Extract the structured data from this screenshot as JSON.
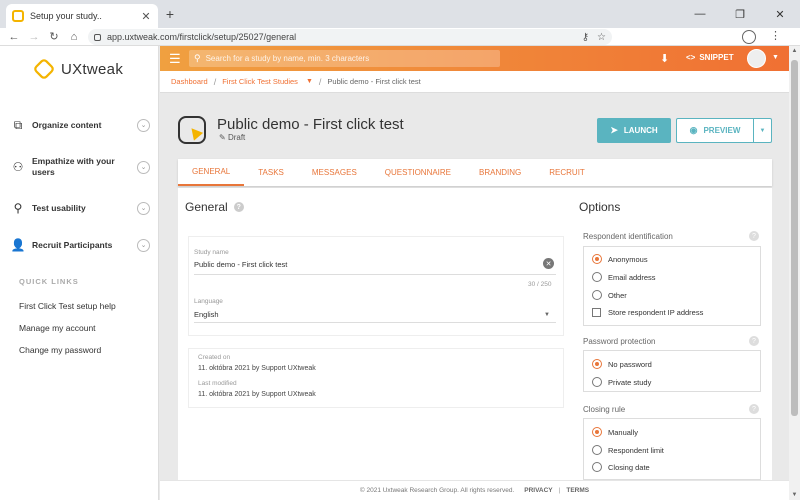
{
  "browser": {
    "tab_title": "Setup your study..",
    "url": "app.uxtweak.com/firstclick/setup/25027/general",
    "new_tab": "+",
    "min": "—",
    "max": "❐",
    "close": "✕"
  },
  "sidebar": {
    "logo": "UXtweak",
    "items": [
      {
        "label": "Organize content",
        "icon": "sitemap-icon"
      },
      {
        "label": "Empathize with your users",
        "icon": "persona-icon"
      },
      {
        "label": "Test usability",
        "icon": "tree-icon"
      },
      {
        "label": "Recruit Participants",
        "icon": "user-icon"
      }
    ],
    "quick_links_heading": "QUICK LINKS",
    "quick_links": [
      "First Click Test setup help",
      "Manage my account",
      "Change my password"
    ]
  },
  "header": {
    "search_placeholder": "Search for a study by name, min. 3 characters",
    "snippet": "SNIPPET"
  },
  "breadcrumb": {
    "dashboard": "Dashboard",
    "studies": "First Click Test Studies",
    "current": "Public demo - First click test"
  },
  "study": {
    "title": "Public demo - First click test",
    "status": "Draft",
    "launch": "LAUNCH",
    "preview": "PREVIEW"
  },
  "tabs": [
    "GENERAL",
    "TASKS",
    "MESSAGES",
    "QUESTIONNAIRE",
    "BRANDING",
    "RECRUIT"
  ],
  "general": {
    "title": "General",
    "study_name_label": "Study name",
    "study_name_value": "Public demo - First click test",
    "char_count": "30 / 250",
    "language_label": "Language",
    "language_value": "English",
    "created_label": "Created on",
    "created_value": "11. októbra 2021 by Support UXtweak",
    "modified_label": "Last modified",
    "modified_value": "11. októbra 2021 by Support UXtweak"
  },
  "options": {
    "title": "Options",
    "respondent_identification": {
      "title": "Respondent identification",
      "choices": [
        "Anonymous",
        "Email address",
        "Other"
      ],
      "selected": "Anonymous",
      "store_ip": "Store respondent IP address"
    },
    "password_protection": {
      "title": "Password protection",
      "choices": [
        "No password",
        "Private study"
      ],
      "selected": "No password"
    },
    "closing_rule": {
      "title": "Closing rule",
      "choices": [
        "Manually",
        "Respondent limit",
        "Closing date"
      ],
      "selected": "Manually"
    }
  },
  "footer": {
    "copyright": "© 2021 Uxtweak Research Group. All rights reserved.",
    "privacy": "PRIVACY",
    "separator": "|",
    "terms": "TERMS"
  },
  "colors": {
    "accent": "#e8763a",
    "teal": "#5ab4c0",
    "brand_yellow": "#f4b400"
  }
}
